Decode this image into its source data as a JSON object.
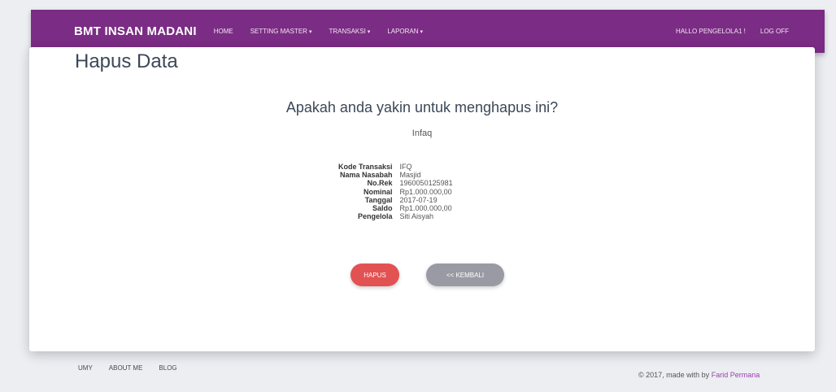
{
  "navbar": {
    "brand": "BMT INSAN MADANI",
    "items": [
      {
        "label": "HOME",
        "dropdown": false
      },
      {
        "label": "SETTING MASTER",
        "dropdown": true
      },
      {
        "label": "TRANSAKSI",
        "dropdown": true
      },
      {
        "label": "LAPORAN",
        "dropdown": true
      }
    ],
    "greeting": "HALLO PENGELOLA1 !",
    "logoff": "LOG OFF",
    "caret": "▾"
  },
  "page": {
    "title": "Hapus Data",
    "question": "Apakah anda yakin untuk menghapus ini?",
    "subject": "Infaq"
  },
  "details": [
    {
      "label": "Kode Transaksi",
      "value": "IFQ"
    },
    {
      "label": "Nama Nasabah",
      "value": "Masjid"
    },
    {
      "label": "No.Rek",
      "value": "1960050125981"
    },
    {
      "label": "Nominal",
      "value": "Rp1.000.000,00"
    },
    {
      "label": "Tanggal",
      "value": "2017-07-19"
    },
    {
      "label": "Saldo",
      "value": "Rp1.000.000,00"
    },
    {
      "label": "Pengelola",
      "value": "Siti Aisyah"
    }
  ],
  "buttons": {
    "delete": "HAPUS",
    "back": "<< KEMBALI"
  },
  "footer": {
    "links": [
      "UMY",
      "ABOUT ME",
      "BLOG"
    ],
    "copyright": "© 2017, made with by",
    "author": "Farid Permana"
  },
  "colors": {
    "navbar": "#7b2c84",
    "delete_button": "#e25252",
    "back_button": "#9a9aa4",
    "author_link": "#9c3fb0"
  }
}
